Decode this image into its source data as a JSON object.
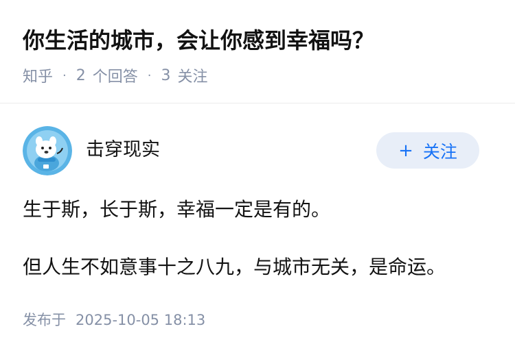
{
  "question": {
    "title": "你生活的城市，会让你感到幸福吗？",
    "source": "知乎",
    "answer_count": "2",
    "answer_label": "个回答",
    "follow_count": "3",
    "follow_label": "关注"
  },
  "author": {
    "name": "击穿现实",
    "avatar_icon": "cartoon-dog-avatar",
    "follow_button_label": "关注",
    "follow_button_icon": "plus-icon"
  },
  "answer": {
    "paragraphs": [
      "生于斯，长于斯，幸福一定是有的。",
      "但人生不如意事十之八九，与城市无关，是命运。"
    ],
    "published_label": "发布于",
    "published_time": "2025-10-05 18:13"
  },
  "colors": {
    "accent": "#1772f6",
    "button_bg": "#e8eef8",
    "meta_text": "#8590a6",
    "main_text": "#121212",
    "avatar_bg": "#5ab4e6"
  }
}
